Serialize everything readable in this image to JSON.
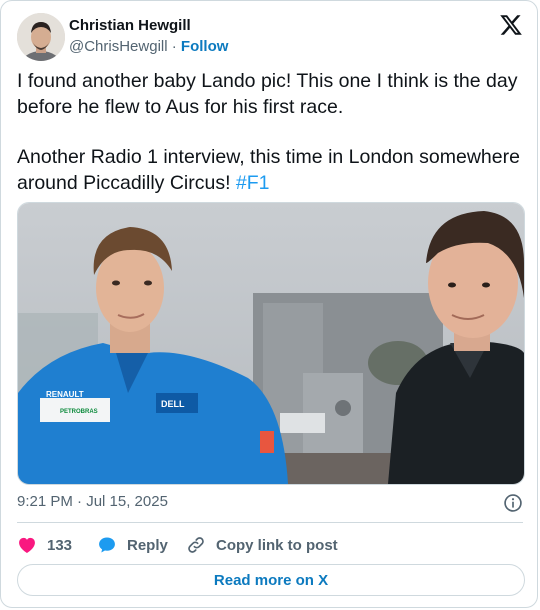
{
  "author": {
    "name": "Christian Hewgill",
    "handle": "@ChrisHewgill",
    "separator": "·",
    "follow_label": "Follow"
  },
  "tweet": {
    "paragraph1": "I found another baby Lando pic! This one I think is the day before he flew to Aus for his first race.",
    "paragraph2_text": "Another Radio 1 interview, this time in London somewhere around Piccadilly Circus! ",
    "hashtag": "#F1"
  },
  "media": {
    "suit_brand_1": "RENAULT",
    "suit_brand_2": "PETROBRAS",
    "suit_brand_3": "DELL"
  },
  "meta": {
    "timestamp": "9:21 PM · Jul 15, 2025"
  },
  "actions": {
    "like_count": "133",
    "reply_label": "Reply",
    "copy_label": "Copy link to post"
  },
  "read_more_label": "Read more on X",
  "colors": {
    "link": "#0c7abf",
    "hashtag": "#1d9bf0",
    "heart": "#f91880",
    "reply_bubble": "#1d9bf0",
    "muted": "#536471"
  },
  "icons": [
    "x-logo-icon",
    "info-icon",
    "heart-icon",
    "reply-icon",
    "link-icon"
  ]
}
